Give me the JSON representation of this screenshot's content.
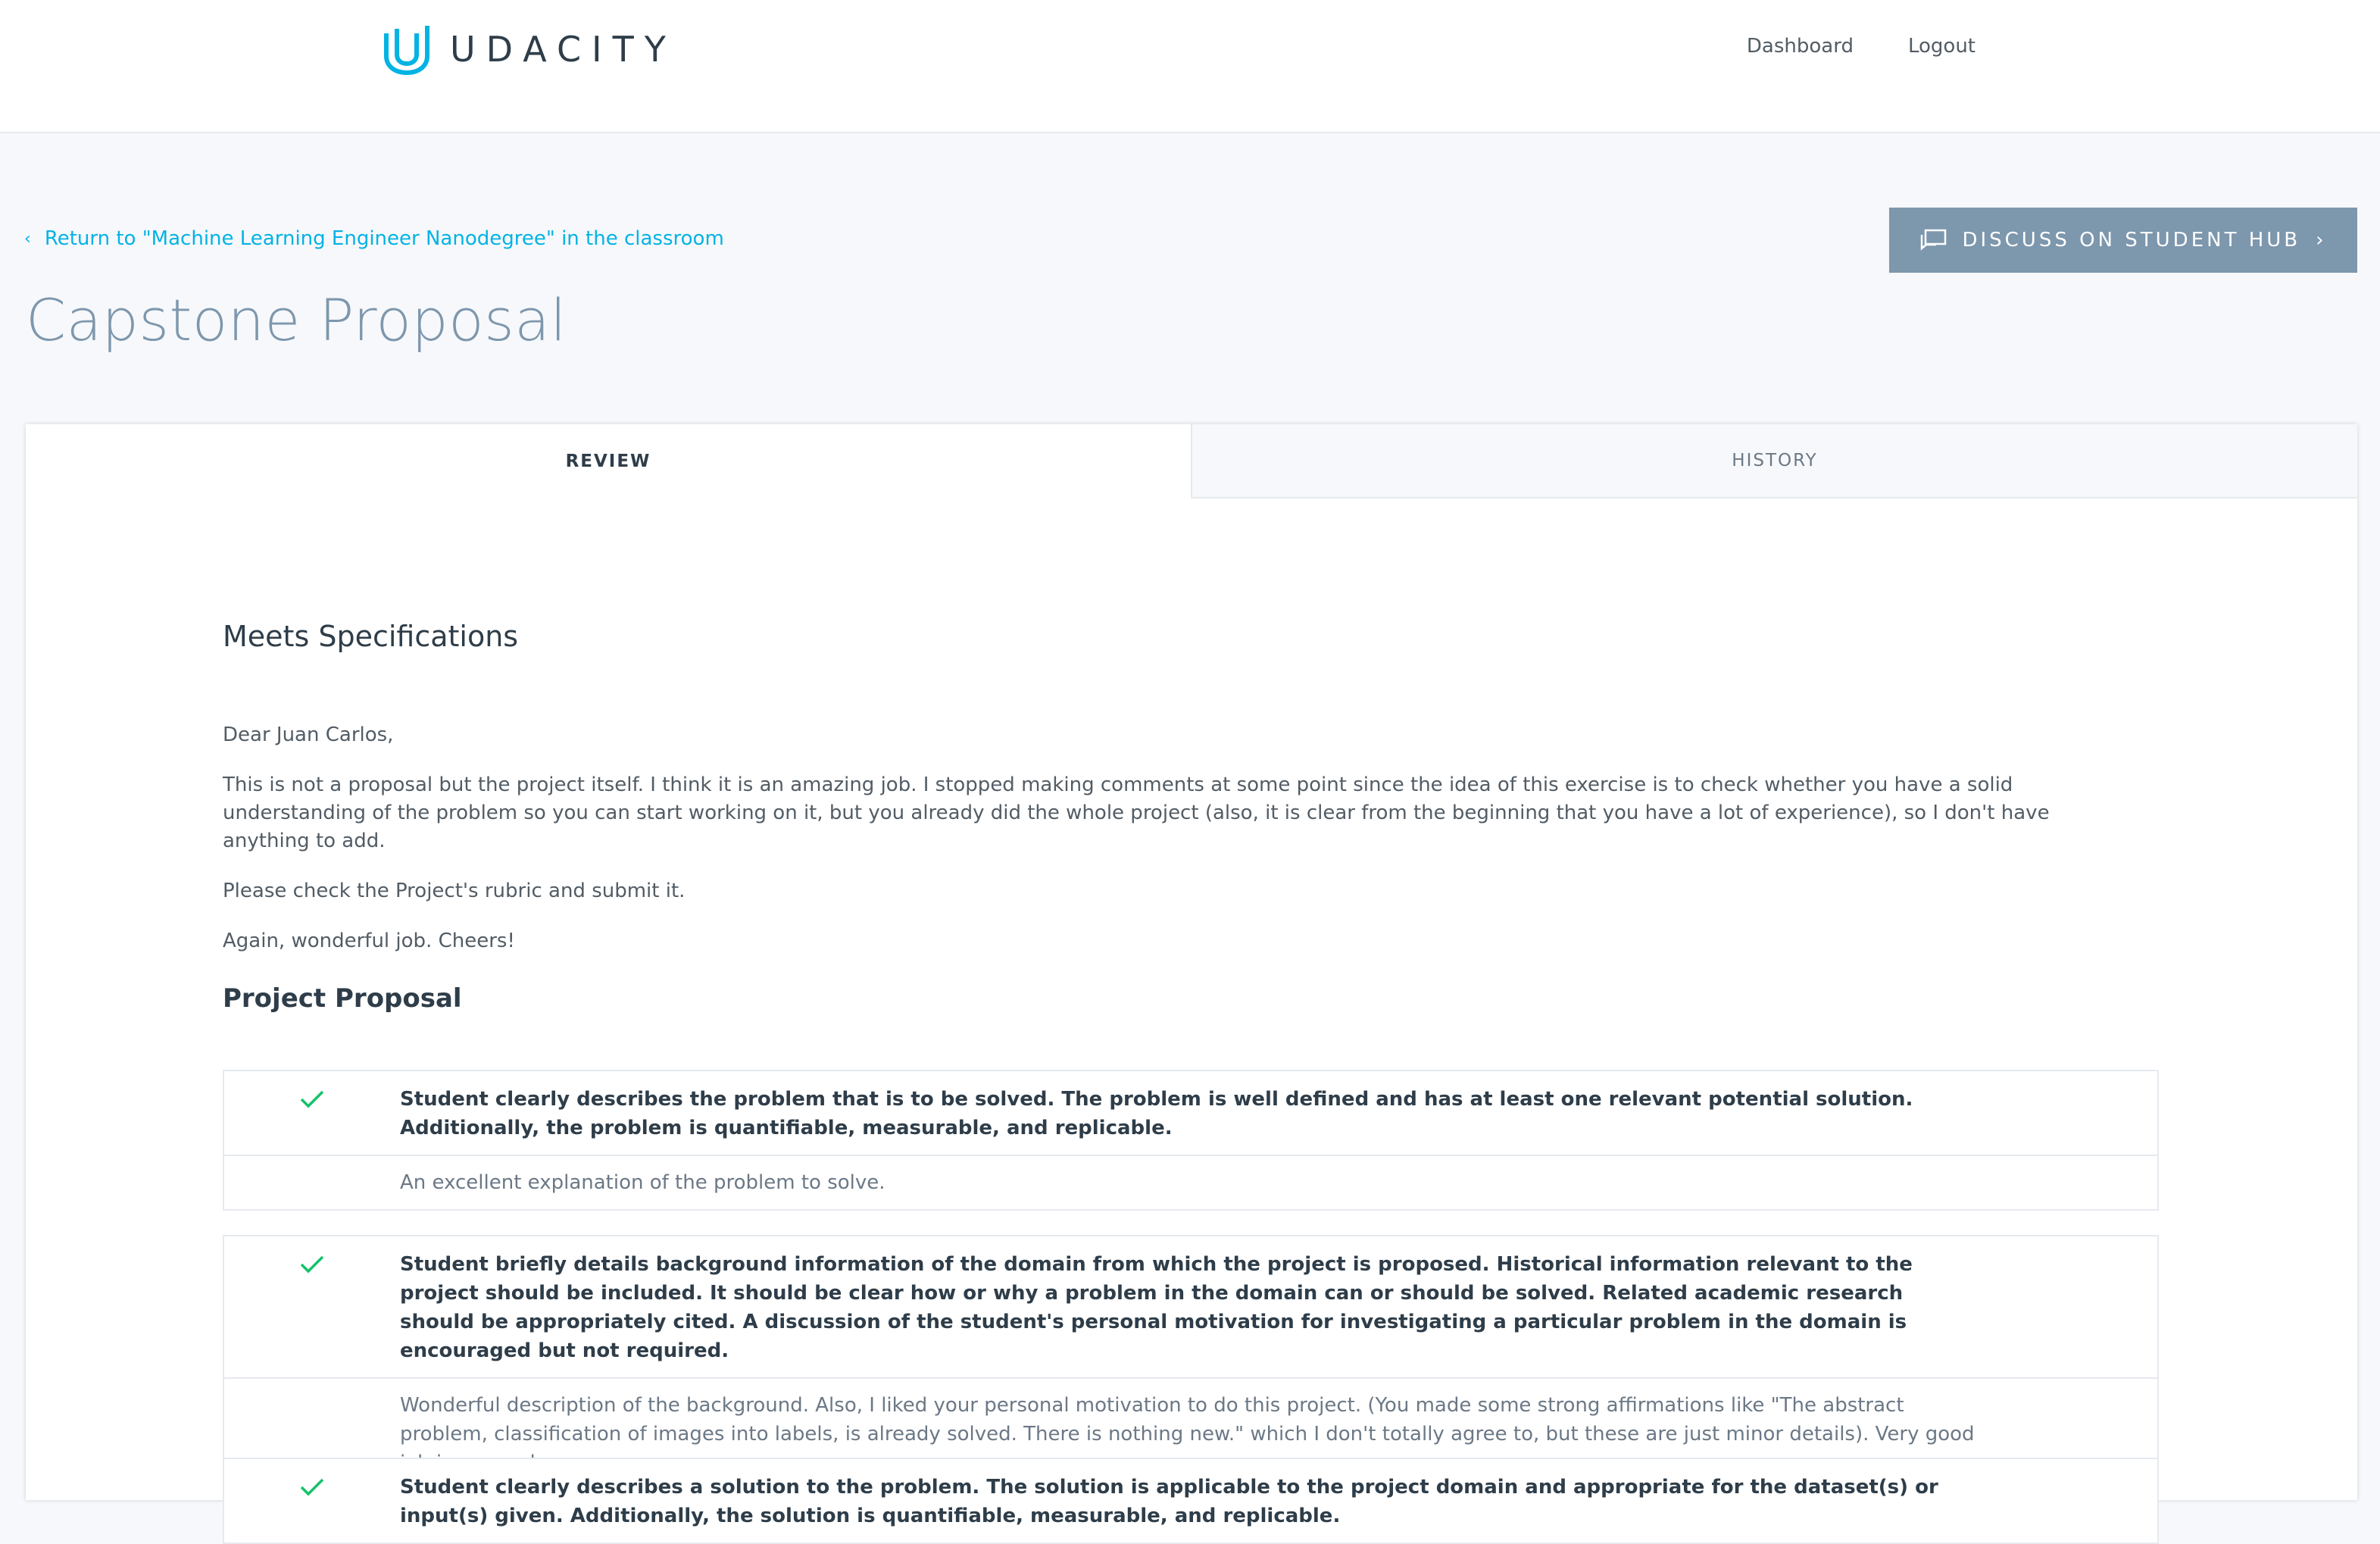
{
  "header": {
    "brand": "UDACITY",
    "nav": [
      {
        "label": "Dashboard"
      },
      {
        "label": "Logout"
      }
    ]
  },
  "page": {
    "back_link": "Return to \"Machine Learning Engineer Nanodegree\" in the classroom",
    "title": "Capstone Proposal",
    "hub_button": "DISCUSS ON STUDENT HUB"
  },
  "tabs": [
    {
      "label": "REVIEW",
      "active": true
    },
    {
      "label": "HISTORY",
      "active": false
    }
  ],
  "review": {
    "status": "Meets Specifications",
    "message": [
      "Dear Juan Carlos,",
      "This is not a proposal but the project itself. I think it is an amazing job. I stopped making comments at some point since the idea of this exercise is to check whether you have a solid understanding of the problem so you can start working on it, but you already did the whole project (also, it is clear from the beginning that you have a lot of experience), so I don't have anything to add.",
      "Please check the Project's rubric and submit it.",
      "Again, wonderful job. Cheers!"
    ],
    "section": "Project Proposal",
    "criteria": [
      {
        "text": "Student clearly describes the problem that is to be solved. The problem is well defined and has at least one relevant potential solution. Additionally, the problem is quantifiable, measurable, and replicable.",
        "comment": "An excellent explanation of the problem to solve."
      },
      {
        "text": "Student briefly details background information of the domain from which the project is proposed. Historical information relevant to the project should be included. It should be clear how or why a problem in the domain can or should be solved. Related academic research should be appropriately cited. A discussion of the student's personal motivation for investigating a particular problem in the domain is encouraged but not required.",
        "comment": "Wonderful description of the background. Also, I liked your personal motivation to do this project. (You made some strong affirmations like \"The abstract problem, classification of images into labels, is already solved. There is nothing new.\" which I don't totally agree to, but these are just minor details). Very good job in general."
      },
      {
        "text": "Student clearly describes a solution to the problem. The solution is applicable to the project domain and appropriate for the dataset(s) or input(s) given. Additionally, the solution is quantifiable, measurable, and replicable.",
        "comment": ""
      }
    ]
  },
  "colors": {
    "accent": "#02b3e4",
    "title": "#7d97ad",
    "check": "#15c26b",
    "hub_button_bg": "#7d97ad"
  },
  "icons": [
    "udacity-logo",
    "chevron-left-icon",
    "chat-icon",
    "chevron-right-icon",
    "check-icon"
  ]
}
